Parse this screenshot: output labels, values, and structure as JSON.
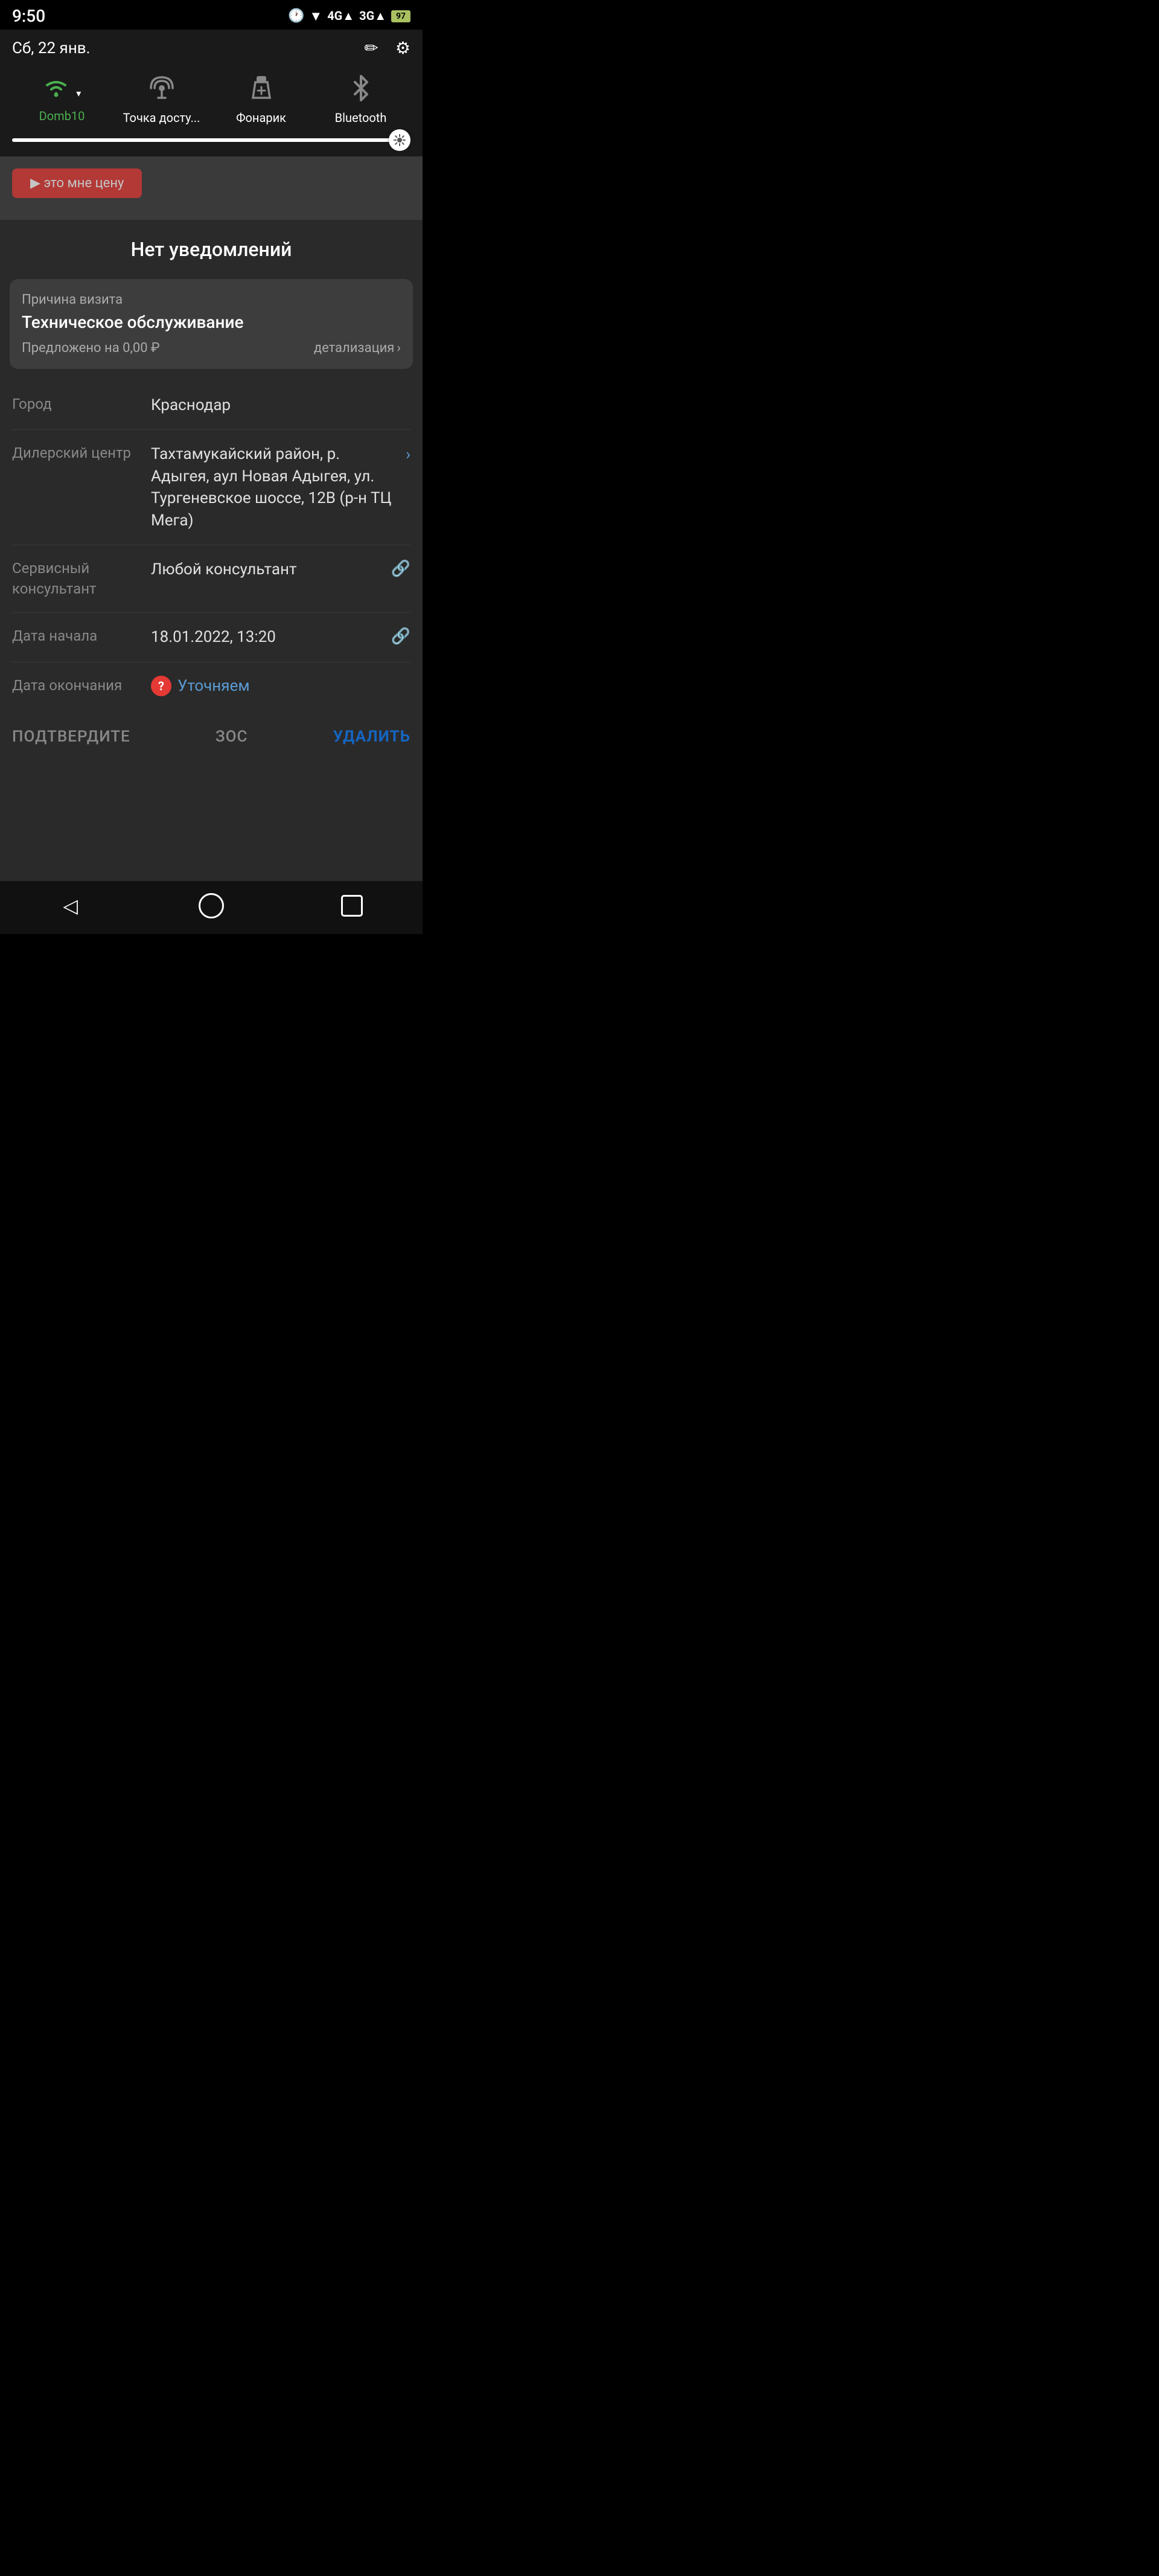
{
  "status_bar": {
    "time": "9:50",
    "battery": "97"
  },
  "panel": {
    "date": "Сб, 22 янв.",
    "edit_icon": "✏",
    "settings_icon": "⚙"
  },
  "quick_settings": [
    {
      "id": "wifi",
      "label": "Domb10",
      "active": true,
      "icon": "wifi"
    },
    {
      "id": "hotspot",
      "label": "Точка досту...",
      "active": false,
      "icon": "hotspot"
    },
    {
      "id": "flashlight",
      "label": "Фонарик",
      "active": false,
      "icon": "flashlight"
    },
    {
      "id": "bluetooth",
      "label": "Bluetooth",
      "active": false,
      "icon": "bluetooth"
    }
  ],
  "no_notifications": "Нет уведомлений",
  "card": {
    "label": "Причина визита",
    "value": "Техническое обслуживание",
    "price_label": "Предложено на 0,00 ₽",
    "detail_label": "детализация"
  },
  "info_rows": [
    {
      "label": "Город",
      "value": "Краснодар",
      "has_edit": false,
      "has_chevron": false,
      "is_clarify": false
    },
    {
      "label": "Дилерский центр",
      "value": "Тахтамукайский район, р. Адыгея, аул Новая Адыгея, ул. Тургеневское шоссе, 12В (р-н ТЦ Мега)",
      "has_edit": false,
      "has_chevron": true,
      "is_clarify": false
    },
    {
      "label": "Сервисный консультант",
      "value": "Любой консультант",
      "has_edit": true,
      "has_chevron": false,
      "is_clarify": false
    },
    {
      "label": "Дата начала",
      "value": "18.01.2022, 13:20",
      "has_edit": true,
      "has_chevron": false,
      "is_clarify": false
    },
    {
      "label": "Дата окончания",
      "value": "Уточняем",
      "has_edit": false,
      "has_chevron": false,
      "is_clarify": true
    }
  ],
  "actions": {
    "confirm": "ПОДТВЕРДИТЕ",
    "book": "ЗОС",
    "delete": "УДАЛИТЬ"
  },
  "nav": {
    "back": "◁",
    "home": "circle",
    "recent": "square"
  }
}
